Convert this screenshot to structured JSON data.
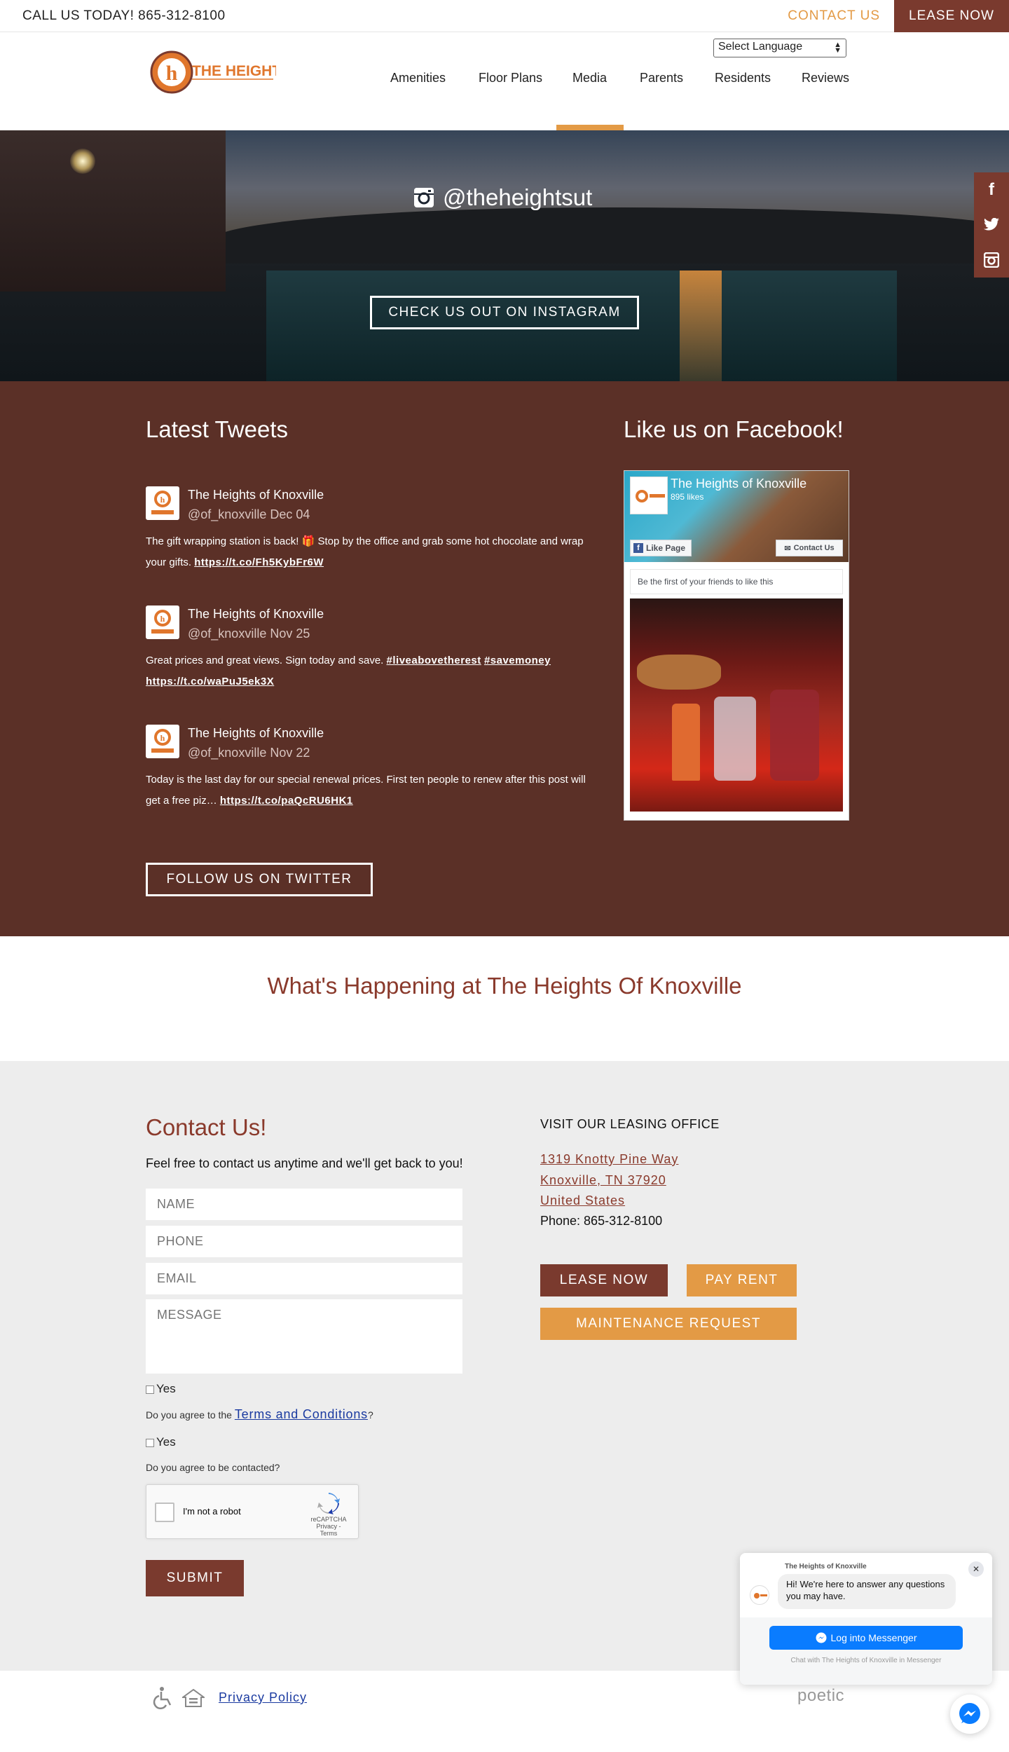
{
  "topbar": {
    "call": "CALL US TODAY! 865-312-8100",
    "contact": "CONTACT US",
    "lease": "LEASE NOW"
  },
  "header": {
    "logo_text": "THE HEIGHTS",
    "language": "Select Language",
    "nav": [
      "Amenities",
      "Floor Plans",
      "Media",
      "Parents",
      "Residents",
      "Reviews"
    ],
    "active_nav": "Media"
  },
  "hero": {
    "handle": "@theheightsut",
    "button": "CHECK US OUT ON INSTAGRAM"
  },
  "social_side": [
    "facebook-icon",
    "twitter-icon",
    "instagram-icon"
  ],
  "tweets": {
    "title": "Latest Tweets",
    "items": [
      {
        "name": "The Heights of Knoxville",
        "handle": "@of_knoxville Dec 04",
        "text": "The gift wrapping station is back! 🎁 Stop by the office and grab some hot chocolate and wrap your gifts. ",
        "links": [
          "https://t.co/Fh5KybFr6W"
        ]
      },
      {
        "name": "The Heights of Knoxville",
        "handle": "@of_knoxville Nov 25",
        "text": "Great prices and great views. Sign today and save. ",
        "links": [
          "#liveabovetherest",
          "#savemoney",
          "https://t.co/waPuJ5ek3X"
        ]
      },
      {
        "name": "The Heights of Knoxville",
        "handle": "@of_knoxville Nov 22",
        "text": "Today is the last day for our special renewal prices. First ten people to renew after this post will get a free piz… ",
        "links": [
          "https://t.co/paQcRU6HK1"
        ]
      }
    ],
    "follow": "FOLLOW US ON TWITTER"
  },
  "facebook": {
    "title": "Like us on Facebook!",
    "page_name": "The Heights of Knoxville",
    "likes": "895 likes",
    "like_button": "Like Page",
    "contact_button": "Contact Us",
    "friends": "Be the first of your friends to like this"
  },
  "happening": {
    "title": "What's Happening at The Heights Of Knoxville"
  },
  "contact": {
    "title": "Contact Us!",
    "intro": "Feel free to contact us anytime and we'll get back to you!",
    "placeholders": {
      "name": "NAME",
      "phone": "PHONE",
      "email": "EMAIL",
      "message": "MESSAGE"
    },
    "yes": "Yes",
    "terms_q_prefix": "Do you agree to the ",
    "terms_link": "Terms and Conditions",
    "terms_q_suffix": "?",
    "contact_q": "Do you agree to be contacted?",
    "recaptcha_label": "I'm not a robot",
    "recaptcha_brand": "reCAPTCHA",
    "recaptcha_links": "Privacy - Terms",
    "submit": "SUBMIT"
  },
  "office": {
    "title": "VISIT OUR LEASING OFFICE",
    "address": [
      "1319 Knotty Pine Way",
      "Knoxville, TN 37920",
      "United States"
    ],
    "phone": "Phone: 865-312-8100",
    "lease": "LEASE NOW",
    "pay": "PAY RENT",
    "maintenance": "MAINTENANCE REQUEST"
  },
  "footer": {
    "privacy": "Privacy Policy",
    "poetic": "poetic"
  },
  "chat": {
    "title": "The Heights of Knoxville",
    "message": "Hi! We're here to answer any questions you may have.",
    "button": "Log into Messenger",
    "foot": "Chat with The Heights of Knoxville in Messenger"
  },
  "colors": {
    "brand": "#7a3a2e",
    "accent": "#e39a45",
    "tweet_bg": "#5b3027",
    "title_red": "#8a3a2c"
  }
}
